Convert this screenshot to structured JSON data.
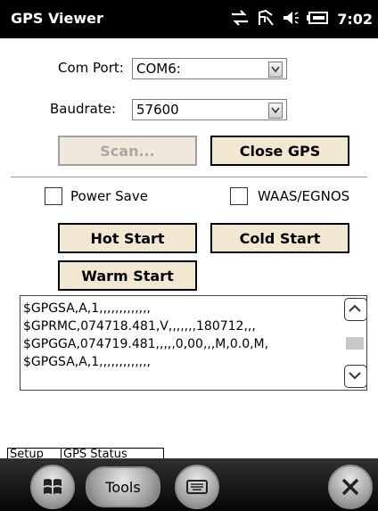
{
  "title_bar": {
    "app_title": "GPS Viewer",
    "clock": "7:02",
    "icons": [
      "connectivity-icon",
      "signal-icon",
      "volume-icon",
      "battery-icon"
    ]
  },
  "setup": {
    "com_port_label": "Com Port:",
    "com_port_value": "COM6:",
    "baudrate_label": "Baudrate:",
    "baudrate_value": "57600",
    "scan_button": "Scan...",
    "close_gps_button": "Close GPS",
    "power_save_label": "Power Save",
    "waas_egnos_label": "WAAS/EGNOS",
    "power_save_checked": false,
    "waas_egnos_checked": false,
    "hot_start_button": "Hot Start",
    "cold_start_button": "Cold Start",
    "warm_start_button": "Warm Start"
  },
  "log_lines": [
    "$GPGSA,A,1,,,,,,,,,,,,,",
    "$GPRMC,074718.481,V,,,,,,,180712,,,",
    "$GPGGA,074719.481,,,,,0,00,,,M,0.0,M,",
    "$GPGSA,A,1,,,,,,,,,,,,,"
  ],
  "tabs": [
    "Setup",
    "GPS Status"
  ],
  "menu_bar": {
    "tools_label": "Tools",
    "icons": [
      "windows-start-icon",
      "keyboard-icon",
      "close-icon"
    ]
  },
  "colors": {
    "button_face": "#f2e8d2",
    "title_bar": "#000000",
    "menu_bar": "#101010"
  }
}
